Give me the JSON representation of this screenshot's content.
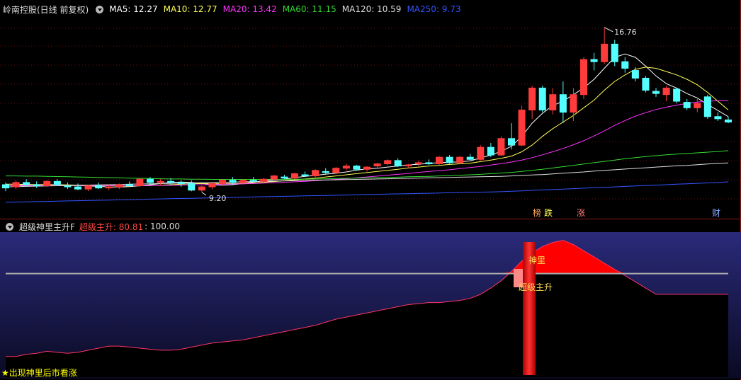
{
  "main_legend": {
    "title": "岭南控股(日线 前复权)",
    "mas": [
      {
        "label": "MA5: 12.27",
        "color": "#ffffff"
      },
      {
        "label": "MA10: 12.77",
        "color": "#ffff55"
      },
      {
        "label": "MA20: 13.42",
        "color": "#ff33ff"
      },
      {
        "label": "MA60: 11.15",
        "color": "#33dd33"
      },
      {
        "label": "MA120: 10.59",
        "color": "#dddddd"
      },
      {
        "label": "MA250: 9.73",
        "color": "#3355ff"
      }
    ]
  },
  "price_annotations": {
    "high": "16.76",
    "low": "9.20"
  },
  "event_markers": [
    {
      "label": "榜",
      "color": "#ffaa55"
    },
    {
      "label": "跌",
      "color": "#ffff55"
    },
    {
      "label": "涨",
      "color": "#ff7777"
    },
    {
      "label": "财",
      "color": "#88aaff"
    }
  ],
  "sub_legend": {
    "title": "超级神里主升F",
    "indicator_label": "超级主升: 80.81",
    "indicator_color": "#ff4444",
    "level_value": ": 100.00"
  },
  "sub_annotations": {
    "shenli": "神里",
    "chaoji": "超级主升"
  },
  "footer_note": "★出现神里后市看涨",
  "colors": {
    "up": "#ff3b3b",
    "down": "#54ffff",
    "grid": "#6a1010",
    "border": "#8b1a1a"
  },
  "chart_data": {
    "type": "candlestick",
    "ohlc": [
      [
        9.6,
        9.7,
        9.3,
        9.45
      ],
      [
        9.5,
        9.8,
        9.4,
        9.7
      ],
      [
        9.7,
        9.85,
        9.55,
        9.6
      ],
      [
        9.6,
        9.75,
        9.45,
        9.55
      ],
      [
        9.55,
        9.8,
        9.5,
        9.75
      ],
      [
        9.75,
        9.85,
        9.55,
        9.6
      ],
      [
        9.55,
        9.7,
        9.4,
        9.5
      ],
      [
        9.5,
        9.65,
        9.35,
        9.4
      ],
      [
        9.4,
        9.6,
        9.3,
        9.55
      ],
      [
        9.55,
        9.7,
        9.4,
        9.45
      ],
      [
        9.45,
        9.6,
        9.35,
        9.5
      ],
      [
        9.5,
        9.65,
        9.4,
        9.6
      ],
      [
        9.6,
        9.75,
        9.5,
        9.55
      ],
      [
        9.55,
        9.9,
        9.5,
        9.85
      ],
      [
        9.85,
        9.95,
        9.6,
        9.7
      ],
      [
        9.7,
        9.85,
        9.55,
        9.75
      ],
      [
        9.75,
        9.9,
        9.6,
        9.7
      ],
      [
        9.7,
        9.8,
        9.5,
        9.65
      ],
      [
        9.65,
        9.8,
        9.3,
        9.35
      ],
      [
        9.35,
        9.55,
        9.25,
        9.5
      ],
      [
        9.5,
        9.7,
        9.4,
        9.65
      ],
      [
        9.65,
        9.85,
        9.55,
        9.8
      ],
      [
        9.8,
        9.95,
        9.6,
        9.7
      ],
      [
        9.7,
        9.85,
        9.6,
        9.8
      ],
      [
        9.8,
        9.95,
        9.7,
        9.75
      ],
      [
        9.75,
        9.9,
        9.65,
        9.85
      ],
      [
        9.85,
        10.05,
        9.8,
        10.0
      ],
      [
        9.95,
        10.05,
        9.85,
        9.9
      ],
      [
        9.9,
        10.15,
        9.85,
        10.1
      ],
      [
        10.05,
        10.2,
        9.95,
        10.0
      ],
      [
        10.0,
        10.3,
        9.95,
        10.25
      ],
      [
        10.2,
        10.35,
        10.1,
        10.15
      ],
      [
        10.15,
        10.4,
        10.1,
        10.35
      ],
      [
        10.35,
        10.55,
        10.25,
        10.45
      ],
      [
        10.45,
        10.5,
        10.25,
        10.3
      ],
      [
        10.3,
        10.45,
        10.2,
        10.4
      ],
      [
        10.45,
        10.6,
        10.35,
        10.55
      ],
      [
        10.55,
        10.75,
        10.5,
        10.7
      ],
      [
        10.7,
        10.8,
        10.4,
        10.45
      ],
      [
        10.45,
        10.55,
        10.35,
        10.5
      ],
      [
        10.55,
        10.7,
        10.45,
        10.6
      ],
      [
        10.6,
        10.75,
        10.5,
        10.55
      ],
      [
        10.55,
        10.9,
        10.5,
        10.85
      ],
      [
        10.85,
        10.95,
        10.55,
        10.6
      ],
      [
        10.6,
        10.9,
        10.55,
        10.85
      ],
      [
        10.85,
        11.0,
        10.7,
        10.75
      ],
      [
        10.75,
        11.4,
        10.7,
        11.3
      ],
      [
        11.3,
        11.5,
        10.85,
        10.95
      ],
      [
        10.95,
        11.8,
        10.9,
        11.7
      ],
      [
        11.7,
        12.4,
        11.2,
        11.4
      ],
      [
        11.4,
        13.2,
        11.35,
        13.0
      ],
      [
        13.0,
        14.1,
        12.6,
        14.0
      ],
      [
        14.0,
        14.1,
        12.9,
        13.0
      ],
      [
        13.0,
        14.0,
        12.8,
        13.7
      ],
      [
        13.7,
        14.3,
        12.4,
        12.9
      ],
      [
        12.9,
        14.0,
        12.5,
        13.7
      ],
      [
        13.7,
        15.4,
        13.5,
        15.3
      ],
      [
        15.3,
        15.6,
        14.8,
        15.2
      ],
      [
        15.2,
        16.76,
        15.1,
        16.0
      ],
      [
        16.0,
        16.2,
        15.0,
        15.2
      ],
      [
        15.2,
        15.4,
        14.7,
        14.9
      ],
      [
        14.8,
        14.95,
        14.3,
        14.45
      ],
      [
        14.45,
        14.55,
        13.8,
        13.9
      ],
      [
        13.85,
        14.0,
        13.6,
        13.75
      ],
      [
        13.7,
        14.1,
        13.4,
        14.0
      ],
      [
        13.95,
        14.0,
        13.3,
        13.4
      ],
      [
        13.35,
        13.5,
        13.0,
        13.1
      ],
      [
        13.1,
        13.5,
        12.9,
        13.3
      ],
      [
        13.6,
        13.7,
        12.6,
        12.7
      ],
      [
        12.7,
        12.9,
        12.5,
        12.6
      ],
      [
        12.55,
        12.7,
        12.4,
        12.45
      ]
    ],
    "ma_lines": [
      {
        "name": "MA5",
        "color": "#ffffff",
        "values": [
          9.55,
          9.57,
          9.58,
          9.6,
          9.61,
          9.6,
          9.58,
          9.56,
          9.54,
          9.52,
          9.5,
          9.49,
          9.51,
          9.55,
          9.6,
          9.65,
          9.7,
          9.72,
          9.7,
          9.66,
          9.6,
          9.58,
          9.6,
          9.65,
          9.72,
          9.78,
          9.82,
          9.85,
          9.92,
          9.98,
          10.02,
          10.08,
          10.12,
          10.18,
          10.26,
          10.32,
          10.35,
          10.4,
          10.45,
          10.5,
          10.53,
          10.57,
          10.6,
          10.62,
          10.64,
          10.68,
          10.82,
          10.95,
          11.12,
          11.35,
          11.8,
          12.4,
          12.85,
          13.2,
          13.4,
          13.7,
          14.0,
          14.4,
          14.9,
          15.4,
          15.55,
          15.4,
          15.0,
          14.55,
          14.2,
          14.0,
          13.75,
          13.55,
          13.25,
          12.98,
          12.7
        ]
      },
      {
        "name": "MA10",
        "color": "#ffff55",
        "values": [
          9.62,
          9.62,
          9.61,
          9.61,
          9.6,
          9.6,
          9.59,
          9.58,
          9.57,
          9.56,
          9.55,
          9.54,
          9.54,
          9.55,
          9.56,
          9.58,
          9.6,
          9.62,
          9.64,
          9.65,
          9.65,
          9.65,
          9.65,
          9.66,
          9.68,
          9.71,
          9.74,
          9.78,
          9.82,
          9.86,
          9.9,
          9.95,
          10.0,
          10.05,
          10.1,
          10.15,
          10.2,
          10.25,
          10.3,
          10.36,
          10.4,
          10.45,
          10.48,
          10.52,
          10.55,
          10.58,
          10.65,
          10.72,
          10.8,
          10.9,
          11.1,
          11.4,
          11.8,
          12.15,
          12.45,
          12.75,
          13.1,
          13.45,
          13.9,
          14.3,
          14.6,
          14.85,
          14.95,
          14.9,
          14.75,
          14.6,
          14.4,
          14.15,
          13.8,
          13.4,
          13.0
        ]
      },
      {
        "name": "MA20",
        "color": "#ff33ff",
        "values": [
          9.55,
          9.55,
          9.55,
          9.56,
          9.56,
          9.56,
          9.56,
          9.56,
          9.56,
          9.56,
          9.56,
          9.56,
          9.56,
          9.56,
          9.56,
          9.57,
          9.57,
          9.58,
          9.59,
          9.6,
          9.61,
          9.62,
          9.63,
          9.64,
          9.65,
          9.67,
          9.69,
          9.71,
          9.73,
          9.75,
          9.78,
          9.81,
          9.84,
          9.87,
          9.91,
          9.95,
          9.99,
          10.03,
          10.07,
          10.11,
          10.16,
          10.2,
          10.24,
          10.28,
          10.33,
          10.38,
          10.43,
          10.49,
          10.56,
          10.63,
          10.72,
          10.83,
          10.96,
          11.1,
          11.25,
          11.42,
          11.6,
          11.82,
          12.05,
          12.3,
          12.52,
          12.72,
          12.88,
          13.02,
          13.13,
          13.22,
          13.3,
          13.36,
          13.4,
          13.42,
          13.42
        ]
      },
      {
        "name": "MA60",
        "color": "#33dd33",
        "values": [
          10.0,
          10.0,
          9.99,
          9.99,
          9.98,
          9.97,
          9.96,
          9.95,
          9.94,
          9.93,
          9.92,
          9.91,
          9.9,
          9.89,
          9.88,
          9.87,
          9.86,
          9.86,
          9.85,
          9.85,
          9.84,
          9.84,
          9.84,
          9.84,
          9.84,
          9.84,
          9.84,
          9.84,
          9.85,
          9.85,
          9.86,
          9.87,
          9.88,
          9.89,
          9.9,
          9.91,
          9.92,
          9.93,
          9.94,
          9.96,
          9.97,
          9.98,
          10.0,
          10.01,
          10.03,
          10.05,
          10.07,
          10.1,
          10.13,
          10.16,
          10.2,
          10.25,
          10.3,
          10.36,
          10.42,
          10.48,
          10.54,
          10.6,
          10.66,
          10.72,
          10.78,
          10.83,
          10.88,
          10.92,
          10.96,
          10.99,
          11.02,
          11.05,
          11.08,
          11.11,
          11.15
        ]
      },
      {
        "name": "MA120",
        "color": "#dddddd",
        "values": [
          9.5,
          9.51,
          9.52,
          9.53,
          9.54,
          9.55,
          9.56,
          9.57,
          9.58,
          9.59,
          9.6,
          9.61,
          9.62,
          9.63,
          9.64,
          9.65,
          9.66,
          9.67,
          9.68,
          9.69,
          9.7,
          9.71,
          9.72,
          9.73,
          9.74,
          9.75,
          9.76,
          9.77,
          9.78,
          9.79,
          9.8,
          9.81,
          9.82,
          9.83,
          9.84,
          9.85,
          9.86,
          9.87,
          9.88,
          9.89,
          9.9,
          9.91,
          9.92,
          9.93,
          9.94,
          9.95,
          9.96,
          9.97,
          9.98,
          10.0,
          10.02,
          10.04,
          10.06,
          10.09,
          10.12,
          10.15,
          10.18,
          10.22,
          10.25,
          10.28,
          10.31,
          10.34,
          10.37,
          10.4,
          10.43,
          10.46,
          10.48,
          10.51,
          10.54,
          10.57,
          10.59
        ]
      },
      {
        "name": "MA250",
        "color": "#3355ff",
        "values": [
          8.8,
          8.81,
          8.82,
          8.83,
          8.84,
          8.85,
          8.86,
          8.87,
          8.88,
          8.89,
          8.9,
          8.91,
          8.92,
          8.93,
          8.94,
          8.95,
          8.96,
          8.97,
          8.98,
          8.99,
          9.0,
          9.01,
          9.02,
          9.03,
          9.04,
          9.05,
          9.06,
          9.07,
          9.08,
          9.09,
          9.1,
          9.11,
          9.12,
          9.13,
          9.14,
          9.15,
          9.16,
          9.17,
          9.18,
          9.19,
          9.2,
          9.21,
          9.22,
          9.23,
          9.24,
          9.25,
          9.26,
          9.27,
          9.28,
          9.3,
          9.32,
          9.34,
          9.36,
          9.38,
          9.4,
          9.42,
          9.44,
          9.46,
          9.48,
          9.5,
          9.52,
          9.54,
          9.56,
          9.58,
          9.6,
          9.62,
          9.64,
          9.66,
          9.68,
          9.7,
          9.73
        ]
      }
    ],
    "indicator": {
      "name": "超级主升",
      "level": 100,
      "values": [
        20,
        20,
        22,
        23,
        25,
        24,
        23,
        24,
        26,
        28,
        30,
        30,
        29,
        28,
        27,
        26,
        26,
        27,
        29,
        31,
        33,
        34,
        35,
        36,
        38,
        40,
        42,
        44,
        46,
        48,
        50,
        53,
        56,
        58,
        60,
        62,
        64,
        66,
        68,
        70,
        71,
        72,
        72,
        73,
        74,
        76,
        80,
        86,
        93,
        102,
        112,
        120,
        126,
        130,
        132,
        128,
        122,
        116,
        110,
        104,
        98,
        92,
        86,
        80,
        80,
        80,
        80,
        80,
        80,
        80,
        80
      ],
      "ylim": [
        0,
        140
      ]
    }
  }
}
